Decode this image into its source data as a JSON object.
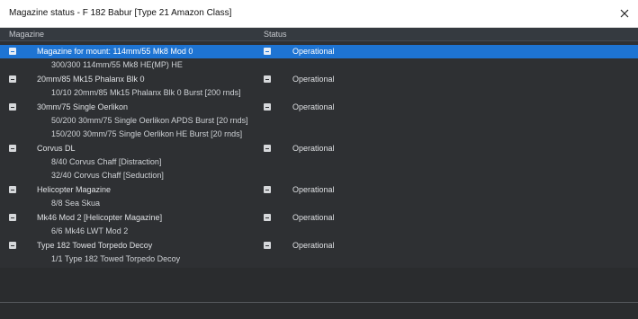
{
  "window": {
    "title": "Magazine status - F 182 Babur [Type 21 Amazon Class]"
  },
  "header": {
    "magazine": "Magazine",
    "status": "Status"
  },
  "rows": [
    {
      "kind": "parent",
      "label": "Magazine for mount: 114mm/55 Mk8 Mod 0",
      "status": "Operational",
      "selected": true
    },
    {
      "kind": "child",
      "label": "300/300 114mm/55 Mk8 HE(MP) HE"
    },
    {
      "kind": "parent",
      "label": "20mm/85 Mk15 Phalanx Blk 0",
      "status": "Operational"
    },
    {
      "kind": "child",
      "label": "10/10 20mm/85 Mk15 Phalanx Blk 0 Burst [200 rnds]"
    },
    {
      "kind": "parent",
      "label": "30mm/75 Single Oerlikon",
      "status": "Operational"
    },
    {
      "kind": "child",
      "label": "50/200 30mm/75 Single Oerlikon APDS Burst [20 rnds]"
    },
    {
      "kind": "child",
      "label": "150/200 30mm/75 Single Oerlikon HE Burst [20 rnds]"
    },
    {
      "kind": "parent",
      "label": "Corvus DL",
      "status": "Operational"
    },
    {
      "kind": "child",
      "label": "8/40 Corvus Chaff [Distraction]"
    },
    {
      "kind": "child",
      "label": "32/40 Corvus Chaff [Seduction]"
    },
    {
      "kind": "parent",
      "label": "Helicopter Magazine",
      "status": "Operational"
    },
    {
      "kind": "child",
      "label": "8/8 Sea Skua"
    },
    {
      "kind": "parent",
      "label": "Mk46 Mod 2 [Helicopter Magazine]",
      "status": "Operational"
    },
    {
      "kind": "child",
      "label": "6/6 Mk46 LWT Mod 2"
    },
    {
      "kind": "parent",
      "label": "Type 182 Towed Torpedo Decoy",
      "status": "Operational"
    },
    {
      "kind": "child",
      "label": "1/1 Type 182 Towed Torpedo Decoy"
    }
  ]
}
